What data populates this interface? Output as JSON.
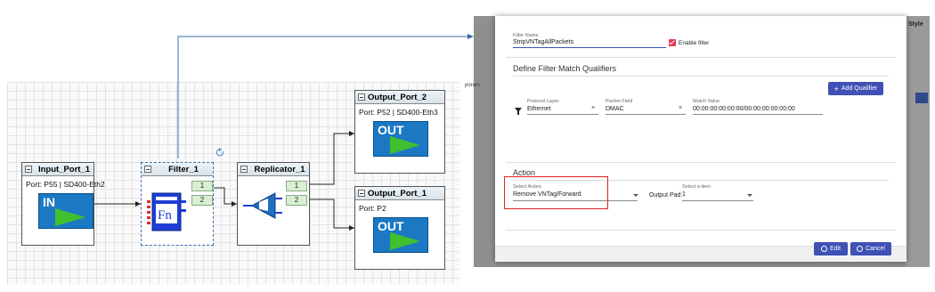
{
  "diagram": {
    "input_port": {
      "title": "Input_Port_1",
      "port": "Port: P55 | SD400-Eth2",
      "badge": "IN"
    },
    "filter": {
      "title": "Filter_1",
      "pad1": "1",
      "pad2": "2"
    },
    "replicator": {
      "title": "Replicator_1",
      "pad1": "1",
      "pad2": "2"
    },
    "output_port_2": {
      "title": "Output_Port_2",
      "port": "Port: P52 | SD400-Eth3",
      "badge": "OUT"
    },
    "output_port_1": {
      "title": "Output_Port_1",
      "port": "Port: P2",
      "badge": "OUT"
    }
  },
  "background": {
    "left_fragment": "ponen",
    "right_fragment": "Style"
  },
  "dialog": {
    "filter_name_label": "Filter Name",
    "filter_name_value": "StripVNTagAllPackets",
    "enable_filter_label": "Enable filter",
    "enable_filter_checked": true,
    "qualifiers_title": "Define Filter Match Qualifiers",
    "add_qualifier_label": "Add Qualifier",
    "qualifier": {
      "protocol_layer_label": "Protocol Layer",
      "protocol_layer_value": "Ethernet",
      "packet_field_label": "Packet Field",
      "packet_field_value": "DMAC",
      "match_value_label": "Match Value",
      "match_value_value": "00:00:00:00:00:00/00:00:00:00:00:00",
      "clear": "×"
    },
    "action_title": "Action",
    "select_action_label": "Select Action",
    "select_action_value": "Remove VNTag/Forward",
    "output_pad_label": "Output Pad:",
    "select_item_label": "Select a item",
    "select_item_value": "1",
    "edit_label": "Edit",
    "cancel_label": "Cancel"
  },
  "colors": {
    "primary": "#3f51b5",
    "badge_blue": "#1b79c4",
    "badge_green": "#3ec12c",
    "highlight_red": "#e02020",
    "checkbox": "#e53a55"
  }
}
